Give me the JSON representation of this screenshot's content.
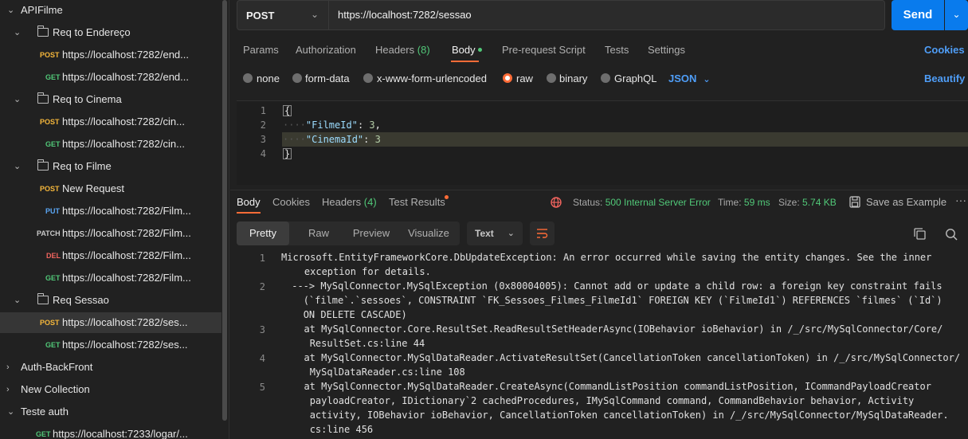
{
  "sidebar": {
    "collection_title": "APIFilme",
    "folders": [
      {
        "name": "Req to Endereço",
        "requests": [
          {
            "method": "POST",
            "name": "https://localhost:7282/end..."
          },
          {
            "method": "GET",
            "name": "https://localhost:7282/end..."
          }
        ]
      },
      {
        "name": "Req to Cinema",
        "requests": [
          {
            "method": "POST",
            "name": "https://localhost:7282/cin..."
          },
          {
            "method": "GET",
            "name": "https://localhost:7282/cin..."
          }
        ]
      },
      {
        "name": "Req to Filme",
        "requests": [
          {
            "method": "POST",
            "name": "New Request"
          },
          {
            "method": "PUT",
            "name": "https://localhost:7282/Film..."
          },
          {
            "method": "PATCH",
            "name": "https://localhost:7282/Film..."
          },
          {
            "method": "DEL",
            "name": "https://localhost:7282/Film..."
          },
          {
            "method": "GET",
            "name": "https://localhost:7282/Film..."
          }
        ]
      },
      {
        "name": "Req Sessao",
        "requests": [
          {
            "method": "POST",
            "name": "https://localhost:7282/ses..."
          },
          {
            "method": "GET",
            "name": "https://localhost:7282/ses..."
          }
        ]
      }
    ],
    "collections": [
      "Auth-BackFront",
      "New Collection",
      "Teste auth"
    ],
    "teste_auth_request": {
      "method": "GET",
      "name": "https://localhost:7233/logar/..."
    }
  },
  "request": {
    "method": "POST",
    "url": "https://localhost:7282/sessao",
    "send_label": "Send"
  },
  "request_tabs": {
    "params": "Params",
    "authorization": "Authorization",
    "headers": "Headers",
    "headers_count": "(8)",
    "body": "Body",
    "prerequest": "Pre-request Script",
    "tests": "Tests",
    "settings": "Settings",
    "cookies": "Cookies"
  },
  "body_types": {
    "none": "none",
    "form_data": "form-data",
    "urlencoded": "x-www-form-urlencoded",
    "raw": "raw",
    "binary": "binary",
    "graphql": "GraphQL",
    "format": "JSON",
    "beautify": "Beautify"
  },
  "editor": {
    "line_numbers": [
      "1",
      "2",
      "3",
      "4"
    ],
    "open_brace": "{",
    "line2_key": "\"FilmeId\"",
    "line2_val": "3",
    "line3_key": "\"CinemaId\"",
    "line3_val": "3",
    "close_brace": "}"
  },
  "response": {
    "tabs": {
      "body": "Body",
      "cookies": "Cookies",
      "headers": "Headers",
      "headers_count": "(4)",
      "test_results": "Test Results"
    },
    "status_label": "Status:",
    "status_value": "500 Internal Server Error",
    "time_label": "Time:",
    "time_value": "59 ms",
    "size_label": "Size:",
    "size_value": "5.74 KB",
    "save_example": "Save as Example",
    "view_tabs": [
      "Pretty",
      "Raw",
      "Preview",
      "Visualize"
    ],
    "text_format": "Text",
    "lines": [
      {
        "n": "1",
        "text": "Microsoft.EntityFrameworkCore.DbUpdateException: An error occurred while saving the entity changes. See the inner\n    exception for details."
      },
      {
        "n": "2",
        "text": " ---> MySqlConnector.MySqlException (0x80004005): Cannot add or update a child row: a foreign key constraint fails\n   (`filme`.`sessoes`, CONSTRAINT `FK_Sessoes_Filmes_FilmeId1` FOREIGN KEY (`FilmeId1`) REFERENCES `filmes` (`Id`)\n   ON DELETE CASCADE)"
      },
      {
        "n": "3",
        "text": "  at MySqlConnector.Core.ResultSet.ReadResultSetHeaderAsync(IOBehavior ioBehavior) in /_/src/MySqlConnector/Core/\n   ResultSet.cs:line 44"
      },
      {
        "n": "4",
        "text": "  at MySqlConnector.MySqlDataReader.ActivateResultSet(CancellationToken cancellationToken) in /_/src/MySqlConnector/\n   MySqlDataReader.cs:line 108"
      },
      {
        "n": "5",
        "text": "  at MySqlConnector.MySqlDataReader.CreateAsync(CommandListPosition commandListPosition, ICommandPayloadCreator\n   payloadCreator, IDictionary`2 cachedProcedures, IMySqlCommand command, CommandBehavior behavior, Activity\n   activity, IOBehavior ioBehavior, CancellationToken cancellationToken) in /_/src/MySqlConnector/MySqlDataReader.\n   cs:line 456"
      }
    ]
  },
  "colors": {
    "accent": "#ff6c37",
    "send": "#097bed",
    "status_ok_text": "#51c878",
    "link": "#4f9ef8"
  }
}
